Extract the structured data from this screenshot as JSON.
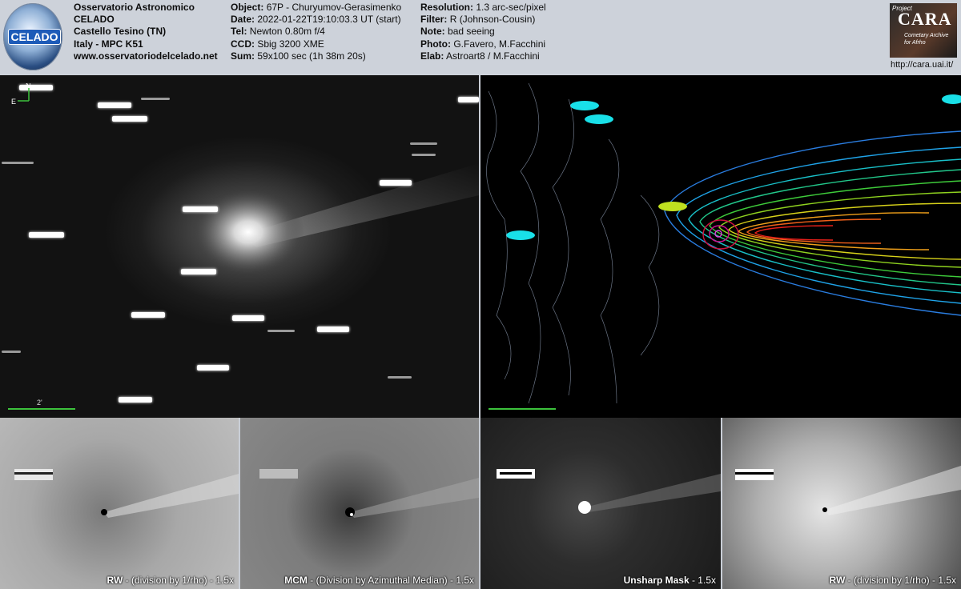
{
  "header": {
    "logo_text": "CELADO",
    "observatory": [
      "Osservatorio Astronomico",
      "CELADO",
      "Castello Tesino (TN)",
      "Italy - MPC K51",
      "www.osservatoriodelcelado.net"
    ],
    "col2": [
      {
        "label": "Object:",
        "value": "67P - Churyumov-Gerasimenko"
      },
      {
        "label": "Date:",
        "value": "2022-01-22T19:10:03.3 UT (start)"
      },
      {
        "label": "Tel:",
        "value": "Newton 0.80m f/4"
      },
      {
        "label": "CCD:",
        "value": "Sbig 3200 XME"
      },
      {
        "label": "Sum:",
        "value": "59x100 sec (1h 38m 20s)"
      }
    ],
    "col3": [
      {
        "label": "Resolution:",
        "value": "1.3 arc-sec/pixel"
      },
      {
        "label": "Filter:",
        "value": "R (Johnson-Cousin)"
      },
      {
        "label": "Note:",
        "value": "bad seeing"
      },
      {
        "label": "Photo:",
        "value": "G.Favero, M.Facchini"
      },
      {
        "label": "Elab:",
        "value": "Astroart8 / M.Facchini"
      }
    ],
    "cara": {
      "project": "Project",
      "title": "CARA",
      "subtitle1": "Cometary Archive",
      "subtitle2": "for Afrho",
      "url": "http://cara.uai.it/"
    }
  },
  "main_panel": {
    "scale_label": "2'",
    "compass_n": "N",
    "compass_e": "E"
  },
  "captions": [
    {
      "bold": "RW",
      "text": " - (division by 1/rho) - 1.5x"
    },
    {
      "bold": "MCM",
      "text": " - (Division by Azimuthal Median) - 1.5x"
    },
    {
      "bold": "Unsharp Mask",
      "text": " - 1.5x"
    },
    {
      "bold": "RW",
      "text": " - (division by 1/rho) - 1.5x"
    }
  ]
}
